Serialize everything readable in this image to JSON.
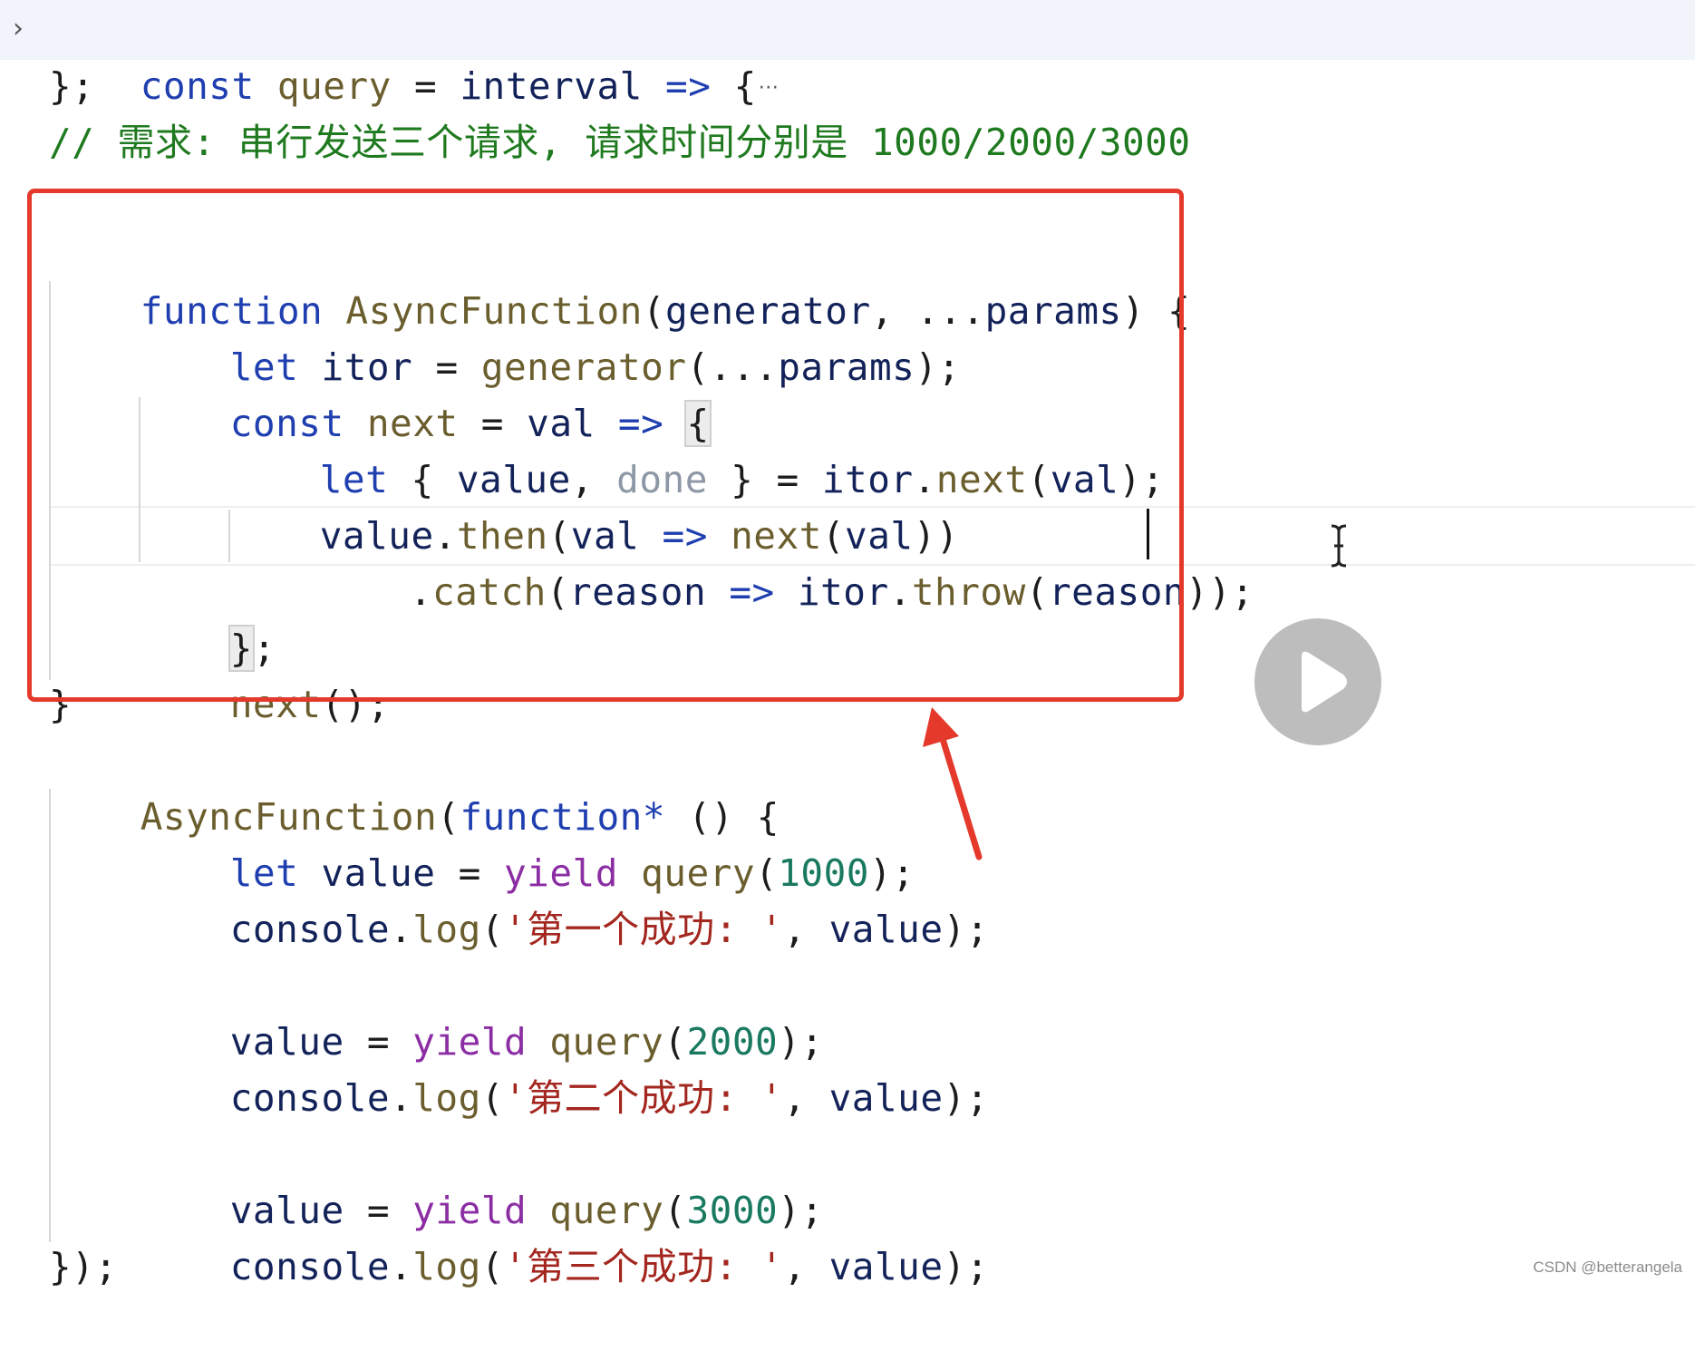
{
  "fold_ellipsis": "···",
  "code": {
    "line1": {
      "kw": "const",
      "name": "query",
      "eq": "=",
      "param": "interval",
      "arrow": "=>",
      "brace": "{"
    },
    "line2": {
      "text": "};"
    },
    "line3": {
      "text": "// 需求: 串行发送三个请求, 请求时间分别是 1000/2000/3000"
    },
    "line4": {
      "kw": "function",
      "name": "AsyncFunction",
      "open": "(",
      "p1": "generator",
      "comma": ", ",
      "spread": "...",
      "p2": "params",
      "close": ") {"
    },
    "line5": {
      "kw": "let",
      "var": "itor",
      "eq": "=",
      "call": "generator",
      "open": "(",
      "spread": "...",
      "arg": "params",
      "close": ");"
    },
    "line6": {
      "kw": "const",
      "name": "next",
      "eq": "=",
      "param": "val",
      "arrow": "=>",
      "brace": "{"
    },
    "line7": {
      "kw": "let",
      "open": "{ ",
      "a": "value",
      "comma": ", ",
      "b": "done",
      "close": " } = ",
      "obj": "itor",
      "dot": ".",
      "method": "next",
      "p": "(",
      "arg": "val",
      "end": ");"
    },
    "line8": {
      "obj": "value",
      "dot": ".",
      "method": "then",
      "p": "(",
      "param": "val",
      "arrow": "=>",
      "call": "next",
      "p2": "(",
      "arg": "val",
      "end": "))"
    },
    "line9": {
      "dot": ".",
      "method": "catch",
      "p": "(",
      "param": "reason",
      "arrow": "=>",
      "obj": "itor",
      "dot2": ".",
      "method2": "throw",
      "p2": "(",
      "arg": "reason",
      "end": "));"
    },
    "line10": {
      "brace": "}",
      "semi": ";"
    },
    "line11": {
      "call": "next",
      "end": "();"
    },
    "line12": {
      "text": "}"
    },
    "line13": {
      "call": "AsyncFunction",
      "p": "(",
      "kw": "function*",
      "rest": " () {"
    },
    "line14": {
      "kw": "let",
      "var": "value",
      "eq": "=",
      "yield": "yield",
      "call": "query",
      "p": "(",
      "num": "1000",
      "end": ");"
    },
    "line15": {
      "obj": "console",
      "dot": ".",
      "method": "log",
      "p": "(",
      "str": "'第一个成功: '",
      "comma": ", ",
      "arg": "value",
      "end": ");"
    },
    "line17": {
      "var": "value",
      "eq": "=",
      "yield": "yield",
      "call": "query",
      "p": "(",
      "num": "2000",
      "end": ");"
    },
    "line18": {
      "obj": "console",
      "dot": ".",
      "method": "log",
      "p": "(",
      "str": "'第二个成功: '",
      "comma": ", ",
      "arg": "value",
      "end": ");"
    },
    "line20": {
      "var": "value",
      "eq": "=",
      "yield": "yield",
      "call": "query",
      "p": "(",
      "num": "3000",
      "end": ");"
    },
    "line21": {
      "obj": "console",
      "dot": ".",
      "method": "log",
      "p": "(",
      "str": "'第三个成功: '",
      "comma": ", ",
      "arg": "value",
      "end": ");"
    },
    "line22": {
      "text": "});"
    }
  },
  "watermark": "CSDN @betterangela",
  "colors": {
    "highlight_box": "#e4392b",
    "arrow": "#e4392b",
    "keyword": "#1f3fb0",
    "yield": "#8c2ea3",
    "string": "#a3271f",
    "number": "#1a7a60",
    "comment": "#1f7a1f"
  },
  "icons": {
    "fold": "chevron-right-icon",
    "play": "play-icon",
    "cursor": "ibeam-cursor-icon",
    "annotation": "arrow-up-icon"
  }
}
